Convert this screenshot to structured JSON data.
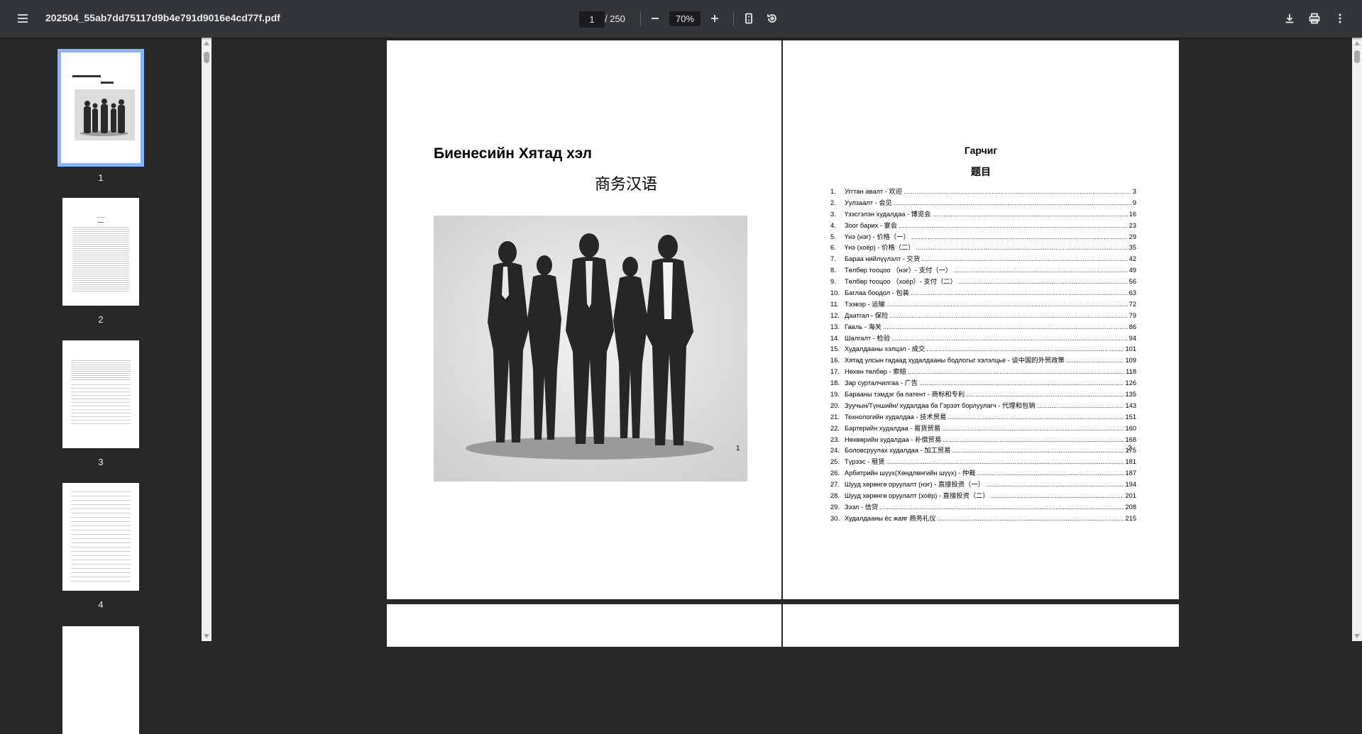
{
  "toolbar": {
    "filename": "202504_55ab7dd75117d9b4e791d9016e4cd77f.pdf",
    "page_current": "1",
    "page_total": "/ 250",
    "zoom": "70%",
    "icons": [
      "menu-icon",
      "zoom-out-icon",
      "zoom-in-icon",
      "fit-page-icon",
      "rotate-icon",
      "download-icon",
      "print-icon",
      "more-icon"
    ]
  },
  "sidebar": {
    "thumbnails": [
      {
        "num": "1",
        "selected": true
      },
      {
        "num": "2",
        "selected": false
      },
      {
        "num": "3",
        "selected": false
      },
      {
        "num": "4",
        "selected": false
      }
    ]
  },
  "page1": {
    "title_mn": "Биенесийн Хятад хэл",
    "title_zh": "商务汉语",
    "page_number": "1"
  },
  "page2": {
    "heading_mn": "Гарчиг",
    "heading_zh": "题目",
    "page_number": "2",
    "toc": [
      {
        "n": "1.",
        "t": "Уггтан авалт - 欢迎",
        "p": "3"
      },
      {
        "n": "2.",
        "t": "Уулзаалт - 会见",
        "p": "9"
      },
      {
        "n": "3.",
        "t": "Үзэсгэлэн худалдаа - 博览会",
        "p": "16"
      },
      {
        "n": "4.",
        "t": "Зоог барих - 宴会",
        "p": "23"
      },
      {
        "n": "5.",
        "t": "Үнэ (нэг) - 价格（一）",
        "p": "29"
      },
      {
        "n": "6.",
        "t": "Үнэ (хоёр) - 价格（二）",
        "p": "35"
      },
      {
        "n": "7.",
        "t": "Бараа нийлүүлэлт - 交货",
        "p": "42"
      },
      {
        "n": "8.",
        "t": "Төлбөр тооцоо （нэг）- 支付（一）",
        "p": "49"
      },
      {
        "n": "9.",
        "t": "Төлбөр тооцоо （хоёр）- 支付（二）",
        "p": "56"
      },
      {
        "n": "10.",
        "t": "Баглаа боодол - 包装",
        "p": "63"
      },
      {
        "n": "11.",
        "t": "Тээвэр - 运输",
        "p": "72"
      },
      {
        "n": "12.",
        "t": "Даатгал - 保险",
        "p": "79"
      },
      {
        "n": "13.",
        "t": "Гааль - 海关",
        "p": "86"
      },
      {
        "n": "14.",
        "t": "Шалгалт - 检验",
        "p": "94"
      },
      {
        "n": "15.",
        "t": "Худалдааны хэлцэл - 成交",
        "p": "101"
      },
      {
        "n": "16.",
        "t": "Хятад улсын гадаад худалдааны бодлогыг хэлэлцье - 谈中国的外贸政策",
        "p": "109"
      },
      {
        "n": "17.",
        "t": "Нөхөн төлбөр - 索赔",
        "p": "118"
      },
      {
        "n": "18.",
        "t": "Зар сурталчилгаа - 广告",
        "p": "126"
      },
      {
        "n": "19.",
        "t": "Барааны тэмдэг ба патент - 商标和专利",
        "p": "135"
      },
      {
        "n": "20.",
        "t": "Зуучын/Түншийн/ худалдаа ба Гэрээт борлуулагч - 代理和包销",
        "p": "143"
      },
      {
        "n": "21.",
        "t": "Технологийн худалдаа - 技术贸易",
        "p": "151"
      },
      {
        "n": "22.",
        "t": "Бартерийн худалдаа - 易货贸易",
        "p": "160"
      },
      {
        "n": "23.",
        "t": "Нөхвөрийн худалдаа - 补偿贸易",
        "p": "168"
      },
      {
        "n": "24.",
        "t": "Боловсруулах худалдаа - 加工贸易",
        "p": "175"
      },
      {
        "n": "25.",
        "t": "Түрээс - 租赁",
        "p": "181"
      },
      {
        "n": "26.",
        "t": "Арбитрийн шүүх(Хөндлөнгийн шүүх) - 仲裁",
        "p": "187"
      },
      {
        "n": "27.",
        "t": "Шууд хөрөнгө оруулалт (нэг) - 直接投资（一）",
        "p": "194"
      },
      {
        "n": "28.",
        "t": "Шууд хөрөнгө оруулалт (хоёр) - 直接投资（二）",
        "p": "201"
      },
      {
        "n": "29.",
        "t": "Зээл - 信贷",
        "p": "208"
      },
      {
        "n": "30.",
        "t": "Худалдааны ёс жаяг 商务礼仪",
        "p": "215"
      }
    ]
  },
  "colors": {
    "toolbar": "#323639",
    "background": "#282828",
    "selection": "#8ab4f8"
  }
}
